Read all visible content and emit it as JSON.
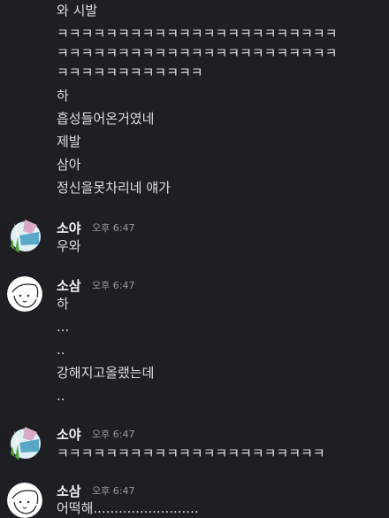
{
  "continuation_lines": [
    "와 시발",
    "ㅋㅋㅋㅋㅋㅋㅋㅋㅋㅋㅋㅋㅋㅋㅋㅋㅋㅋㅋㅋㅋㅋㅋ",
    "ㅋㅋㅋㅋㅋㅋㅋㅋㅋㅋㅋㅋㅋㅋㅋㅋㅋㅋㅋㅋㅋㅋㅋ",
    "ㅋㅋㅋㅋㅋㅋㅋㅋㅋㅋㅋㅋ",
    "하",
    "흡성들어온거였네",
    "제발",
    "삼아",
    "정신을못차리네 얘가"
  ],
  "groups": [
    {
      "author": "소야",
      "time": "오후 6:47",
      "avatar": "soya-avatar",
      "lines": [
        "우와"
      ]
    },
    {
      "author": "소삼",
      "time": "오후 6:47",
      "avatar": "sosam-avatar",
      "lines": [
        "하",
        "...",
        "..",
        "강해지고올랬는데",
        ".."
      ]
    },
    {
      "author": "소야",
      "time": "오후 6:47",
      "avatar": "soya-avatar",
      "lines": [
        "ㅋㅋㅋㅋㅋㅋㅋㅋㅋㅋㅋㅋㅋㅋㅋㅋㅋㅋㅋㅋㅋㅋ"
      ]
    },
    {
      "author": "소삼",
      "time": "오후 6:47",
      "avatar": "sosam-avatar",
      "lines": [
        "어떡해........................."
      ]
    }
  ]
}
